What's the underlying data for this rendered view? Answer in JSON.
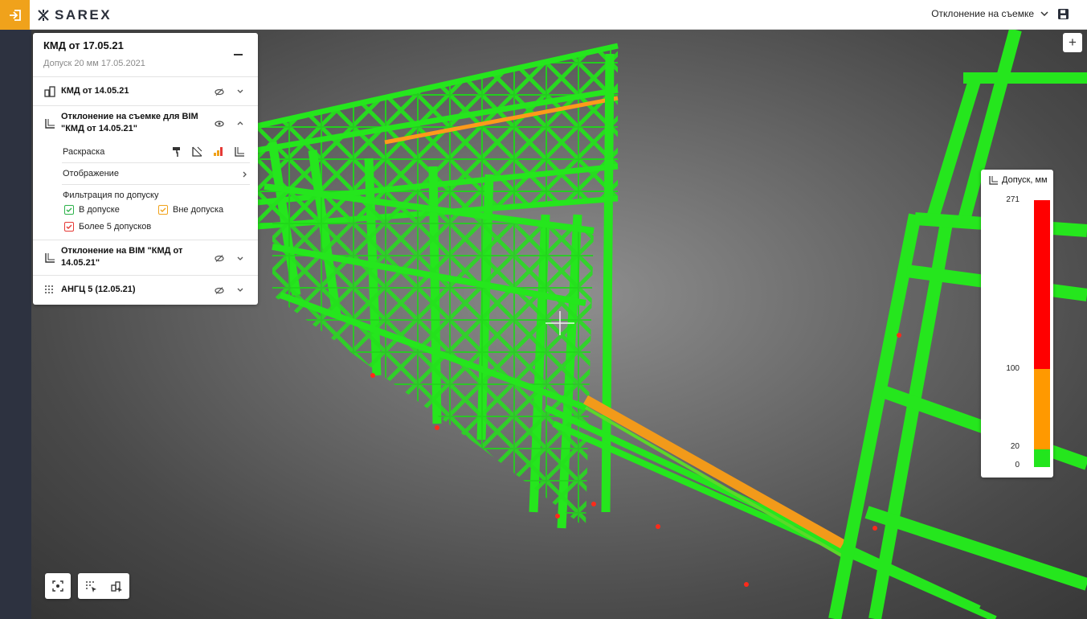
{
  "app": {
    "logo_text": "SAREX"
  },
  "header": {
    "view_select_value": "Отклонение на съемке"
  },
  "panel": {
    "title": "КМД от 17.05.21",
    "subtitle": "Допуск 20 мм 17.05.2021",
    "layers": [
      {
        "label": "КМД от 14.05.21",
        "icon": "buildings-icon",
        "visibility": "hidden"
      },
      {
        "label_line1": "Отклонение на съемке для BIM",
        "label_line2": "\"КМД от 14.05.21\"",
        "icon": "deviation-icon",
        "visibility": "visible"
      },
      {
        "label_line1": "Отклонение на BIM \"КМД от",
        "label_line2": "14.05.21\"",
        "icon": "deviation-icon",
        "visibility": "hidden"
      },
      {
        "label": "АНГЦ 5 (12.05.21)",
        "icon": "pointcloud-icon",
        "visibility": "hidden"
      }
    ],
    "coloring_label": "Раскраска",
    "display_label": "Отображение",
    "filter_label": "Фильтрация по допуску",
    "filters": [
      {
        "label": "В допуске",
        "color": "#2db24a",
        "checked": true
      },
      {
        "label": "Вне допуска",
        "color": "#f0a21b",
        "checked": true
      },
      {
        "label": "Более 5 допусков",
        "color": "#e53935",
        "checked": true
      }
    ]
  },
  "legend": {
    "title": "Допуск, мм",
    "max": 271,
    "bands": [
      {
        "from": 0,
        "to": 20,
        "color": "#22e51d"
      },
      {
        "from": 20,
        "to": 100,
        "color": "#ff9900"
      },
      {
        "from": 100,
        "to": 271,
        "color": "#ff0000"
      }
    ],
    "ticks": [
      "271",
      "100",
      "20",
      "0"
    ]
  },
  "colors": {
    "accent": "#f0a21b",
    "in_tolerance": "#22e51d",
    "out_tolerance": "#ff9900",
    "exceeded": "#ff0000"
  }
}
